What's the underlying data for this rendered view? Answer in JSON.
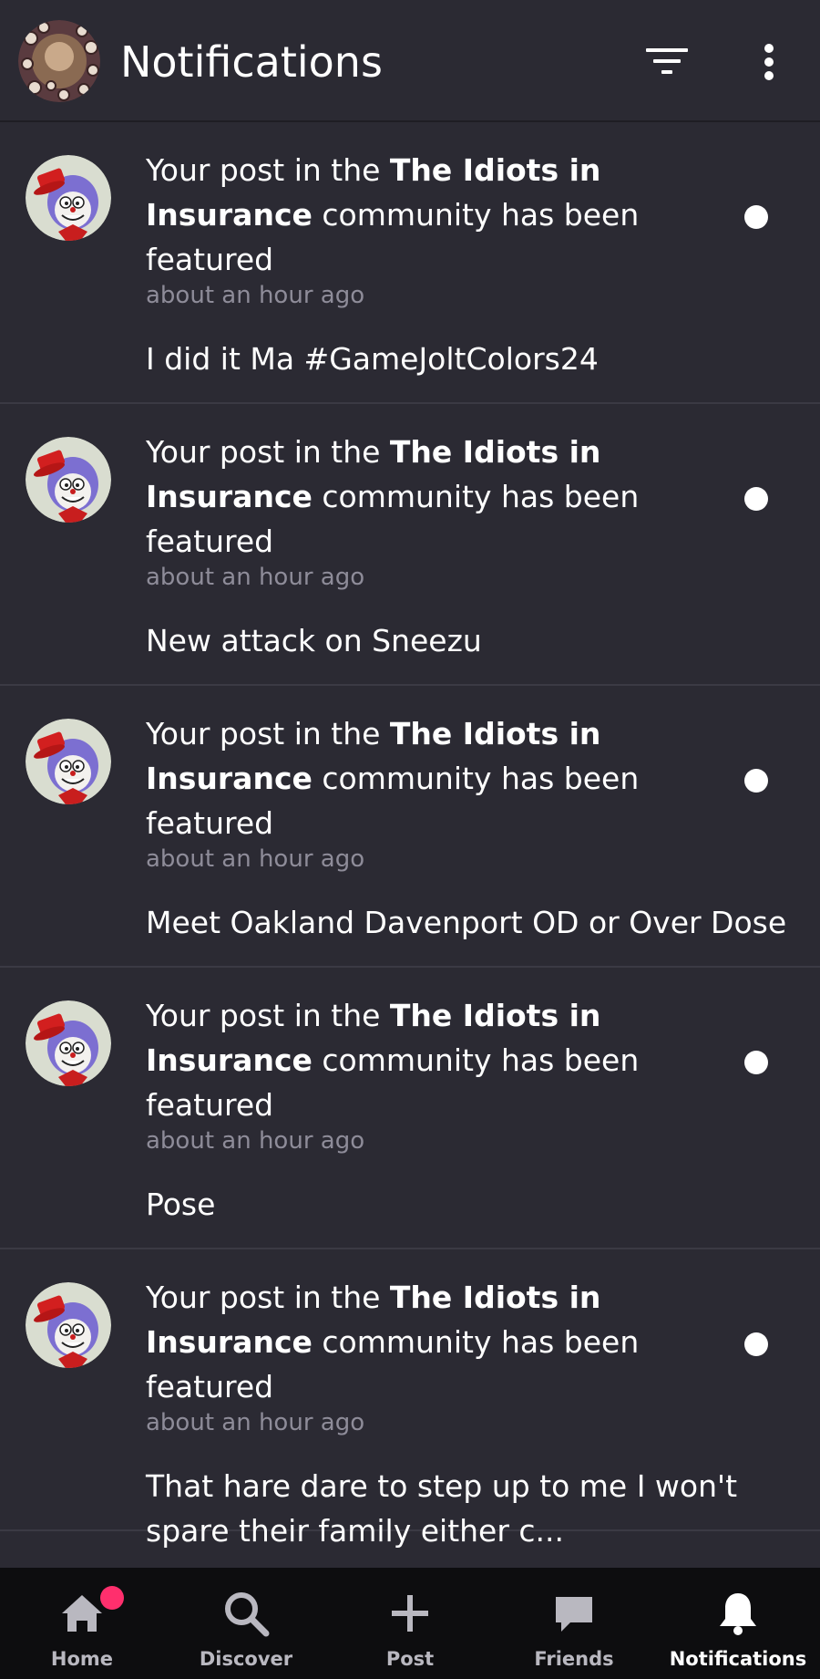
{
  "header": {
    "title": "Notifications",
    "icons": {
      "avatar": "user-avatar",
      "filter": "filter-icon",
      "more": "more-vertical-icon"
    }
  },
  "notifications": [
    {
      "prefix": "Your post in the ",
      "community": "The Idiots in Insurance",
      "suffix": " community has been featured",
      "time": "about an hour ago",
      "snippet": "I did it Ma #GameJoltColors24"
    },
    {
      "prefix": "Your post in the ",
      "community": "The Idiots in Insurance",
      "suffix": " community has been featured",
      "time": "about an hour ago",
      "snippet": "New attack on Sneezu"
    },
    {
      "prefix": "Your post in the ",
      "community": "The Idiots in Insurance",
      "suffix": " community has been featured",
      "time": "about an hour ago",
      "snippet": "Meet Oakland Davenport OD or Over Dose"
    },
    {
      "prefix": "Your post in the ",
      "community": "The Idiots in Insurance",
      "suffix": " community has been featured",
      "time": "about an hour ago",
      "snippet": "Pose"
    },
    {
      "prefix": "Your post in the ",
      "community": "The Idiots in Insurance",
      "suffix": " community has been featured",
      "time": "about an hour ago",
      "snippet": "That hare dare to step up to me I won't spare their family either c..."
    }
  ],
  "nav": [
    {
      "label": "Home",
      "icon": "home-icon",
      "badge": true
    },
    {
      "label": "Discover",
      "icon": "search-icon"
    },
    {
      "label": "Post",
      "icon": "plus-icon"
    },
    {
      "label": "Friends",
      "icon": "chat-icon"
    },
    {
      "label": "Notifications",
      "icon": "bell-icon",
      "active": true
    }
  ],
  "colors": {
    "background": "#2b2a33",
    "navbar": "#0d0d0f",
    "muted_text": "#8e8c99",
    "badge": "#ff2f6d"
  }
}
